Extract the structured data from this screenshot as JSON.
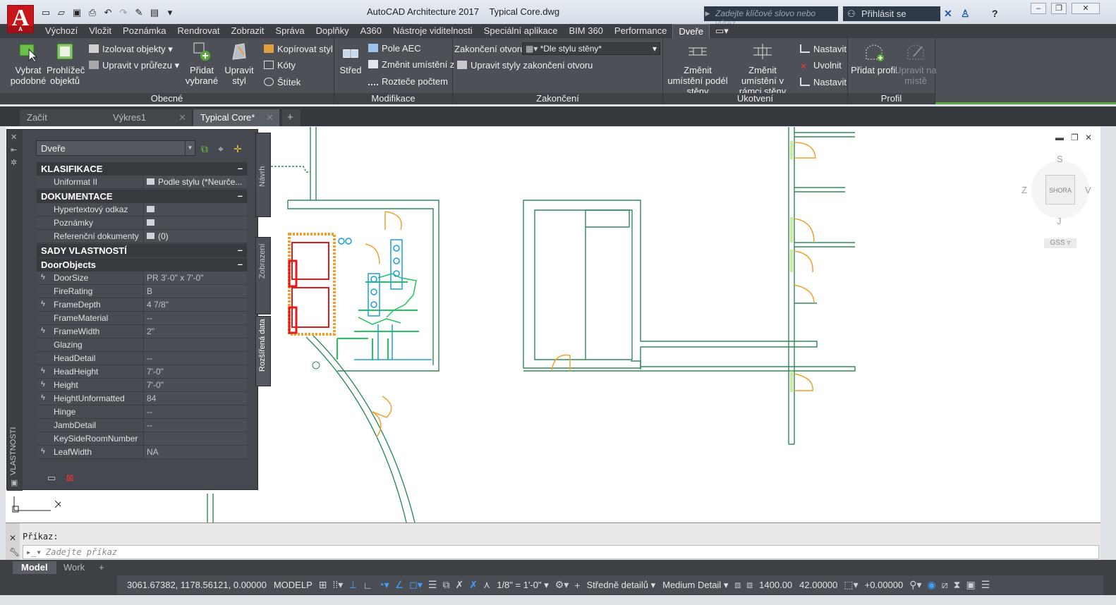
{
  "app": {
    "title": "AutoCAD Architecture 2017",
    "file": "Typical Core.dwg",
    "logo_letter": "A",
    "logo_sub": "A",
    "search_placeholder": "Zadejte klíčové slovo nebo výraz.",
    "signin": "Přihlásit se"
  },
  "ribbon_tabs": [
    "Výchozí",
    "Vložit",
    "Poznámka",
    "Rendrovat",
    "Zobrazit",
    "Správa",
    "Doplňky",
    "A360",
    "Nástroje viditelnosti",
    "Speciální aplikace",
    "BIM 360",
    "Performance",
    "Dveře"
  ],
  "ribbon_active_tab": "Dveře",
  "panels": {
    "general": {
      "title": "Obecné",
      "select_similar": "Vybrat podobné",
      "browser": "Prohlížeč objektů",
      "isolate": "Izolovat objekty",
      "edit_section": "Upravit v průřezu",
      "add_selected": "Přidat vybrané",
      "edit_style": "Upravit styl",
      "copy_style": "Kopírovat styl",
      "dimensions": "Kóty",
      "tag": "Štítek"
    },
    "modify": {
      "title": "Modifikace",
      "center": "Střed",
      "aec_array": "Pole AEC",
      "change_placement": "Změnit umístění z",
      "spacing_count": "Rozteče počtem"
    },
    "endings": {
      "title": "Zakončení",
      "opening_label": "Zakončení otvoru",
      "opening_value": "*Dle stylu stěny*",
      "edit_styles": "Upravit styly zakončení otvoru"
    },
    "anchor": {
      "title": "Ukotvení",
      "along_wall": "Změnit umístění podél stěny",
      "within_wall": "Změnit umístění v rámci stěny",
      "set1": "Nastavit",
      "release": "Uvolnit",
      "set2": "Nastavit"
    },
    "profile": {
      "title": "Profil",
      "add_profile": "Přidat profil",
      "edit_in_place": "Upravit na místě"
    }
  },
  "doc_tabs": [
    {
      "label": "Začít"
    },
    {
      "label": "Výkres1"
    },
    {
      "label": "Typical Core*"
    }
  ],
  "palette": {
    "vertical_title": "VLASTNOSTI",
    "side_tabs": [
      "Návrh",
      "Zobrazení",
      "Rozšířená data"
    ],
    "object_type": "Dveře",
    "sections": {
      "classification": "KLASIFIKACE",
      "documentation": "DOKUMENTACE",
      "property_sets": "SADY VLASTNOSTÍ",
      "door_objects": "DoorObjects"
    },
    "classification_rows": [
      {
        "key": "Uniformat II",
        "value": "Podle stylu (*Neurče..."
      }
    ],
    "documentation_rows": [
      {
        "key": "Hypertextový odkaz",
        "value": ""
      },
      {
        "key": "Poznámky",
        "value": ""
      },
      {
        "key": "Referenční dokumenty",
        "value": "(0)"
      }
    ],
    "door_rows": [
      {
        "key": "DoorSize",
        "value": "PR 3'-0\" x 7'-0\"",
        "bolt": true
      },
      {
        "key": "FireRating",
        "value": "B",
        "bolt": false
      },
      {
        "key": "FrameDepth",
        "value": "4 7/8\"",
        "bolt": true
      },
      {
        "key": "FrameMaterial",
        "value": "--",
        "bolt": false
      },
      {
        "key": "FrameWidth",
        "value": "2\"",
        "bolt": true
      },
      {
        "key": "Glazing",
        "value": "",
        "bolt": false
      },
      {
        "key": "HeadDetail",
        "value": "--",
        "bolt": false
      },
      {
        "key": "HeadHeight",
        "value": "7'-0\"",
        "bolt": true
      },
      {
        "key": "Height",
        "value": "7'-0\"",
        "bolt": true
      },
      {
        "key": "HeightUnformatted",
        "value": "84",
        "bolt": true
      },
      {
        "key": "Hinge",
        "value": "--",
        "bolt": false
      },
      {
        "key": "JambDetail",
        "value": "--",
        "bolt": false
      },
      {
        "key": "KeySideRoomNumber",
        "value": "",
        "bolt": false
      },
      {
        "key": "LeafWidth",
        "value": "NA",
        "bolt": true
      }
    ]
  },
  "viewcube": {
    "top_face": "SHORA",
    "north": "S",
    "south": "J",
    "west": "Z",
    "east": "V",
    "wcs": "GSS"
  },
  "command": {
    "label": "Příkaz:",
    "placeholder": "Zadejte příkaz"
  },
  "layout_tabs": [
    "Model",
    "Work"
  ],
  "status": {
    "coords": "3061.67382, 1178.56121, 0.00000",
    "model": "MODELP",
    "scale": "1/8\" = 1'-0\"",
    "detail_cz": "Středně detailů",
    "detail_en": "Medium Detail",
    "elev1": "1400.00",
    "elev2": "42.00000",
    "offset": "+0.00000"
  },
  "colors": {
    "accent_green": "#5aa63c",
    "ribbon_bg": "#4d5157",
    "drawing_wall": "#2e8b57",
    "door_swing": "#f0a030",
    "fixture_red": "#e41b1b",
    "fixture_cyan": "#1aa0d8",
    "fixture_green": "#22c55e"
  }
}
